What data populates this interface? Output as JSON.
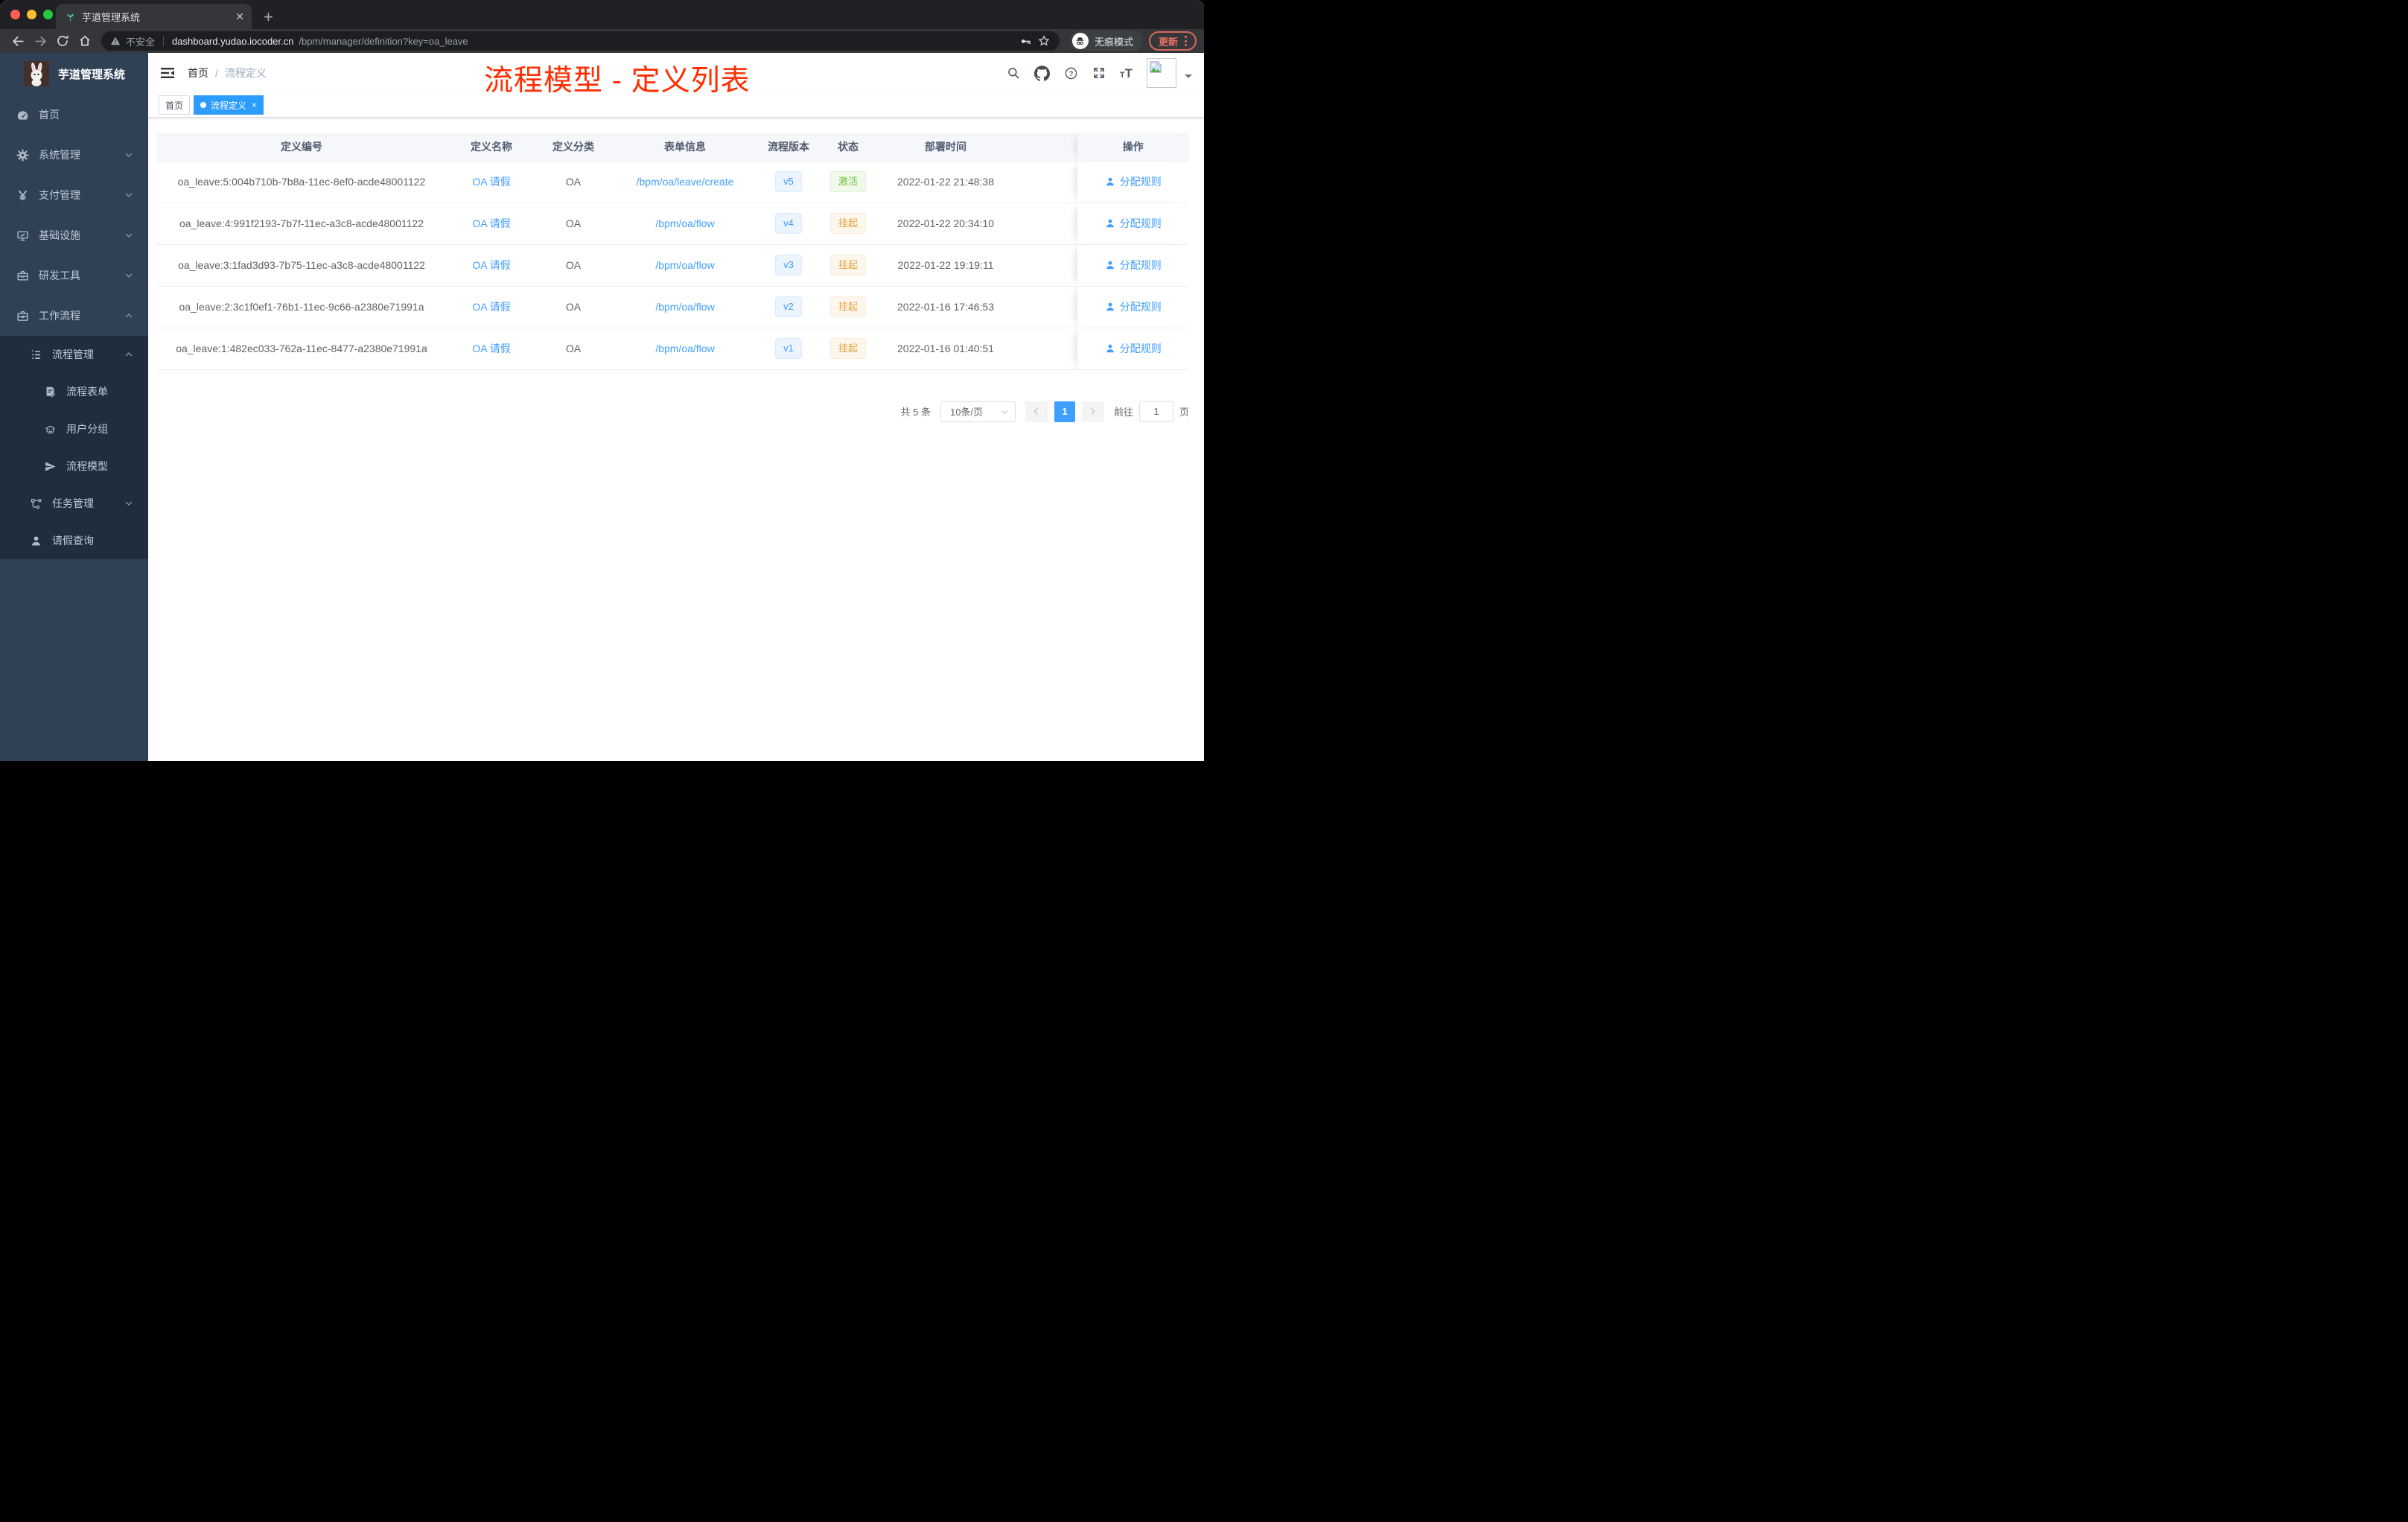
{
  "browser": {
    "tab_title": "芋道管理系统",
    "security_label": "不安全",
    "url_domain": "dashboard.yudao.iocoder.cn",
    "url_path": "/bpm/manager/definition?key=oa_leave",
    "incognito_label": "无痕模式",
    "update_label": "更新"
  },
  "sidebar": {
    "app_title": "芋道管理系统",
    "top_items": [
      {
        "label": "首页",
        "icon": "dashboard-icon",
        "chevron": ""
      },
      {
        "label": "系统管理",
        "icon": "gear-icon",
        "chevron": "down"
      },
      {
        "label": "支付管理",
        "icon": "yen-icon",
        "chevron": "down"
      },
      {
        "label": "基础设施",
        "icon": "monitor-icon",
        "chevron": "down"
      },
      {
        "label": "研发工具",
        "icon": "toolbox-icon",
        "chevron": "down"
      },
      {
        "label": "工作流程",
        "icon": "briefcase-icon",
        "chevron": "up"
      }
    ],
    "sub_items": [
      {
        "label": "流程管理",
        "icon": "tree-list-icon",
        "chevron": "up",
        "level": 2
      },
      {
        "label": "流程表单",
        "icon": "form-edit-icon",
        "chevron": "",
        "level": 3
      },
      {
        "label": "用户分组",
        "icon": "robot-icon",
        "chevron": "",
        "level": 3
      },
      {
        "label": "流程模型",
        "icon": "paper-plane-icon",
        "chevron": "",
        "level": 3
      },
      {
        "label": "任务管理",
        "icon": "sitemap-icon",
        "chevron": "down",
        "level": 2
      },
      {
        "label": "请假查询",
        "icon": "user-icon",
        "chevron": "",
        "level": 2
      }
    ]
  },
  "navbar": {
    "breadcrumb_home": "首页",
    "breadcrumb_separator": "/",
    "breadcrumb_current": "流程定义"
  },
  "tags": [
    {
      "label": "首页",
      "active": false,
      "closable": false
    },
    {
      "label": "流程定义",
      "active": true,
      "closable": true
    }
  ],
  "annotation": {
    "text": "流程模型 - 定义列表",
    "color": "#ff2d00"
  },
  "table": {
    "headers": [
      "定义编号",
      "定义名称",
      "定义分类",
      "表单信息",
      "流程版本",
      "状态",
      "部署时间",
      "操作"
    ],
    "rows": [
      {
        "id": "oa_leave:5:004b710b-7b8a-11ec-8ef0-acde48001122",
        "name": "OA 请假",
        "category": "OA",
        "form": "/bpm/oa/leave/create",
        "version": "v5",
        "status": "激活",
        "status_type": "success",
        "time": "2022-01-22 21:48:38",
        "action": "分配规则"
      },
      {
        "id": "oa_leave:4:991f2193-7b7f-11ec-a3c8-acde48001122",
        "name": "OA 请假",
        "category": "OA",
        "form": "/bpm/oa/flow",
        "version": "v4",
        "status": "挂起",
        "status_type": "warning",
        "time": "2022-01-22 20:34:10",
        "action": "分配规则"
      },
      {
        "id": "oa_leave:3:1fad3d93-7b75-11ec-a3c8-acde48001122",
        "name": "OA 请假",
        "category": "OA",
        "form": "/bpm/oa/flow",
        "version": "v3",
        "status": "挂起",
        "status_type": "warning",
        "time": "2022-01-22 19:19:11",
        "action": "分配规则"
      },
      {
        "id": "oa_leave:2:3c1f0ef1-76b1-11ec-9c66-a2380e71991a",
        "name": "OA 请假",
        "category": "OA",
        "form": "/bpm/oa/flow",
        "version": "v2",
        "status": "挂起",
        "status_type": "warning",
        "time": "2022-01-16 17:46:53",
        "action": "分配规则"
      },
      {
        "id": "oa_leave:1:482ec033-762a-11ec-8477-a2380e71991a",
        "name": "OA 请假",
        "category": "OA",
        "form": "/bpm/oa/flow",
        "version": "v1",
        "status": "挂起",
        "status_type": "warning",
        "time": "2022-01-16 01:40:51",
        "action": "分配规则"
      }
    ]
  },
  "pagination": {
    "total": "共 5 条",
    "page_size": "10条/页",
    "current_page": "1",
    "goto_label": "前往",
    "goto_value": "1",
    "page_unit": "页"
  },
  "colors": {
    "accent": "#409eff",
    "tag_active": "#2d9cff",
    "sidebar_bg": "#304156",
    "submenu_bg": "#1f2d3d",
    "annotation": "#ff2d00",
    "success": "#67c23a",
    "warning": "#e6a23c"
  }
}
